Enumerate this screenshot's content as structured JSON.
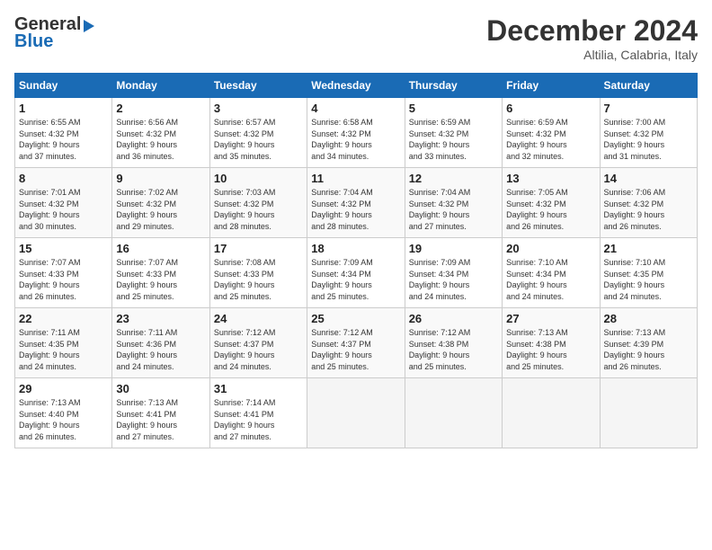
{
  "logo": {
    "text1": "General",
    "text2": "Blue"
  },
  "title": "December 2024",
  "subtitle": "Altilia, Calabria, Italy",
  "weekdays": [
    "Sunday",
    "Monday",
    "Tuesday",
    "Wednesday",
    "Thursday",
    "Friday",
    "Saturday"
  ],
  "weeks": [
    [
      {
        "day": "1",
        "info": "Sunrise: 6:55 AM\nSunset: 4:32 PM\nDaylight: 9 hours\nand 37 minutes."
      },
      {
        "day": "2",
        "info": "Sunrise: 6:56 AM\nSunset: 4:32 PM\nDaylight: 9 hours\nand 36 minutes."
      },
      {
        "day": "3",
        "info": "Sunrise: 6:57 AM\nSunset: 4:32 PM\nDaylight: 9 hours\nand 35 minutes."
      },
      {
        "day": "4",
        "info": "Sunrise: 6:58 AM\nSunset: 4:32 PM\nDaylight: 9 hours\nand 34 minutes."
      },
      {
        "day": "5",
        "info": "Sunrise: 6:59 AM\nSunset: 4:32 PM\nDaylight: 9 hours\nand 33 minutes."
      },
      {
        "day": "6",
        "info": "Sunrise: 6:59 AM\nSunset: 4:32 PM\nDaylight: 9 hours\nand 32 minutes."
      },
      {
        "day": "7",
        "info": "Sunrise: 7:00 AM\nSunset: 4:32 PM\nDaylight: 9 hours\nand 31 minutes."
      }
    ],
    [
      {
        "day": "8",
        "info": "Sunrise: 7:01 AM\nSunset: 4:32 PM\nDaylight: 9 hours\nand 30 minutes."
      },
      {
        "day": "9",
        "info": "Sunrise: 7:02 AM\nSunset: 4:32 PM\nDaylight: 9 hours\nand 29 minutes."
      },
      {
        "day": "10",
        "info": "Sunrise: 7:03 AM\nSunset: 4:32 PM\nDaylight: 9 hours\nand 28 minutes."
      },
      {
        "day": "11",
        "info": "Sunrise: 7:04 AM\nSunset: 4:32 PM\nDaylight: 9 hours\nand 28 minutes."
      },
      {
        "day": "12",
        "info": "Sunrise: 7:04 AM\nSunset: 4:32 PM\nDaylight: 9 hours\nand 27 minutes."
      },
      {
        "day": "13",
        "info": "Sunrise: 7:05 AM\nSunset: 4:32 PM\nDaylight: 9 hours\nand 26 minutes."
      },
      {
        "day": "14",
        "info": "Sunrise: 7:06 AM\nSunset: 4:32 PM\nDaylight: 9 hours\nand 26 minutes."
      }
    ],
    [
      {
        "day": "15",
        "info": "Sunrise: 7:07 AM\nSunset: 4:33 PM\nDaylight: 9 hours\nand 26 minutes."
      },
      {
        "day": "16",
        "info": "Sunrise: 7:07 AM\nSunset: 4:33 PM\nDaylight: 9 hours\nand 25 minutes."
      },
      {
        "day": "17",
        "info": "Sunrise: 7:08 AM\nSunset: 4:33 PM\nDaylight: 9 hours\nand 25 minutes."
      },
      {
        "day": "18",
        "info": "Sunrise: 7:09 AM\nSunset: 4:34 PM\nDaylight: 9 hours\nand 25 minutes."
      },
      {
        "day": "19",
        "info": "Sunrise: 7:09 AM\nSunset: 4:34 PM\nDaylight: 9 hours\nand 24 minutes."
      },
      {
        "day": "20",
        "info": "Sunrise: 7:10 AM\nSunset: 4:34 PM\nDaylight: 9 hours\nand 24 minutes."
      },
      {
        "day": "21",
        "info": "Sunrise: 7:10 AM\nSunset: 4:35 PM\nDaylight: 9 hours\nand 24 minutes."
      }
    ],
    [
      {
        "day": "22",
        "info": "Sunrise: 7:11 AM\nSunset: 4:35 PM\nDaylight: 9 hours\nand 24 minutes."
      },
      {
        "day": "23",
        "info": "Sunrise: 7:11 AM\nSunset: 4:36 PM\nDaylight: 9 hours\nand 24 minutes."
      },
      {
        "day": "24",
        "info": "Sunrise: 7:12 AM\nSunset: 4:37 PM\nDaylight: 9 hours\nand 24 minutes."
      },
      {
        "day": "25",
        "info": "Sunrise: 7:12 AM\nSunset: 4:37 PM\nDaylight: 9 hours\nand 25 minutes."
      },
      {
        "day": "26",
        "info": "Sunrise: 7:12 AM\nSunset: 4:38 PM\nDaylight: 9 hours\nand 25 minutes."
      },
      {
        "day": "27",
        "info": "Sunrise: 7:13 AM\nSunset: 4:38 PM\nDaylight: 9 hours\nand 25 minutes."
      },
      {
        "day": "28",
        "info": "Sunrise: 7:13 AM\nSunset: 4:39 PM\nDaylight: 9 hours\nand 26 minutes."
      }
    ],
    [
      {
        "day": "29",
        "info": "Sunrise: 7:13 AM\nSunset: 4:40 PM\nDaylight: 9 hours\nand 26 minutes."
      },
      {
        "day": "30",
        "info": "Sunrise: 7:13 AM\nSunset: 4:41 PM\nDaylight: 9 hours\nand 27 minutes."
      },
      {
        "day": "31",
        "info": "Sunrise: 7:14 AM\nSunset: 4:41 PM\nDaylight: 9 hours\nand 27 minutes."
      },
      {
        "day": "",
        "info": ""
      },
      {
        "day": "",
        "info": ""
      },
      {
        "day": "",
        "info": ""
      },
      {
        "day": "",
        "info": ""
      }
    ]
  ]
}
